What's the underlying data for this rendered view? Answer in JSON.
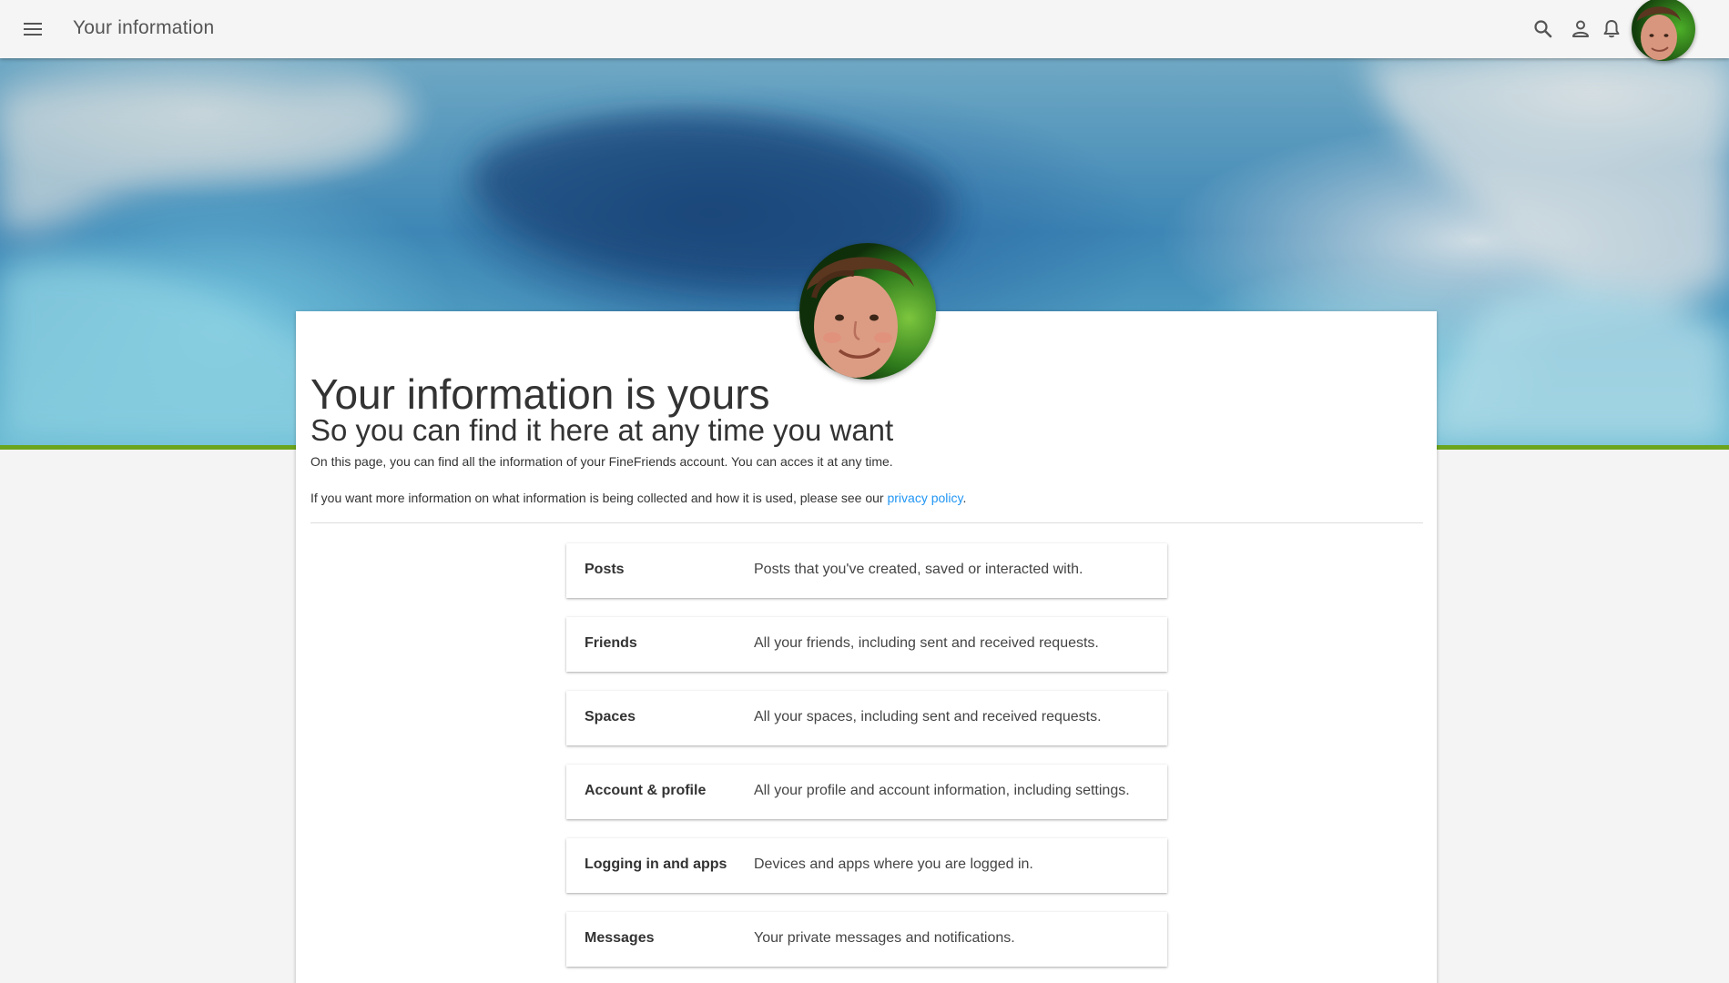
{
  "app": {
    "title": "Your information"
  },
  "topbar": {
    "icons": [
      "menu-icon",
      "search-icon",
      "person-icon",
      "bell-icon"
    ]
  },
  "hero": {
    "headline": "Your information is yours",
    "subheadline": "So you can find it here at any time you want",
    "intro": "On this page, you can find all the information of your FineFriends account. You can acces it at any time.",
    "more_info_prefix": "If you want more information on what information is being collected and how it is used, please see our ",
    "privacy_link": "privacy policy",
    "more_info_suffix": "."
  },
  "categories": [
    {
      "name": "Posts",
      "description": "Posts that you've created, saved or interacted with."
    },
    {
      "name": "Friends",
      "description": "All your friends, including sent and received requests."
    },
    {
      "name": "Spaces",
      "description": "All your spaces, including sent and received requests."
    },
    {
      "name": "Account & profile",
      "description": "All your profile and account information, including settings."
    },
    {
      "name": "Logging in and apps",
      "description": "Devices and apps where you are logged in."
    },
    {
      "name": "Messages",
      "description": "Your private messages and notifications."
    }
  ],
  "colors": {
    "accent_stripe": "#6ba51e",
    "link": "#2196f3",
    "topbar_bg": "#f5f5f5"
  }
}
